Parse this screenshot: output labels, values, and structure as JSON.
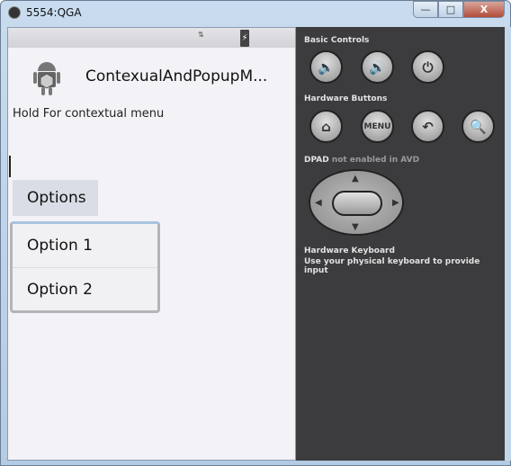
{
  "window": {
    "title": "5554:QGA",
    "minimize": "—",
    "maximize": "□",
    "close": "X"
  },
  "app": {
    "title": "ContexualAndPopupM...",
    "hint": "Hold For contextual menu",
    "options_button": "Options",
    "popup_items": [
      "Option 1",
      "Option 2"
    ]
  },
  "status": {
    "signal": "⇅",
    "battery": "⚡"
  },
  "panel": {
    "basic_controls": "Basic Controls",
    "hardware_buttons": "Hardware Buttons",
    "menu_label": "MENU",
    "dpad_title": "DPAD",
    "dpad_note": "not enabled in AVD",
    "keyboard_title": "Hardware Keyboard",
    "keyboard_note": "Use your physical keyboard to provide input"
  }
}
